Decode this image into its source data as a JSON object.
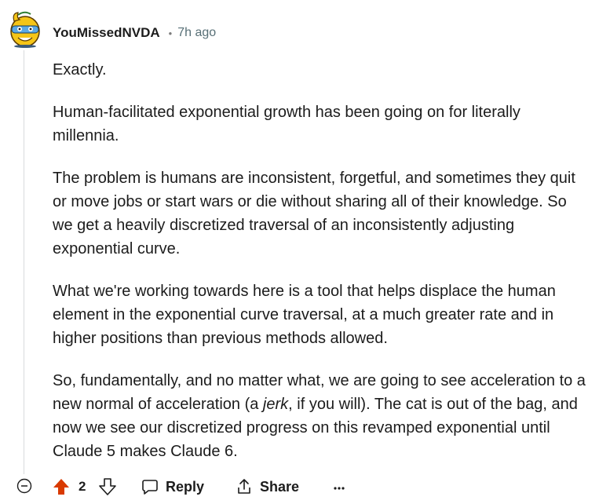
{
  "comment": {
    "username": "YouMissedNVDA",
    "separator": "•",
    "time": "7h ago",
    "paragraphs": {
      "p1": "Exactly.",
      "p2": "Human-facilitated exponential growth has been going on for literally millennia.",
      "p3": "The problem is humans are inconsistent, forgetful, and sometimes they quit or move jobs or start wars or die without sharing all of their knowledge. So we get a heavily discretized traversal of an inconsistently adjusting exponential curve.",
      "p4": "What we're working towards here is a tool that helps displace the human element in the exponential curve traversal, at a much greater rate and in higher positions than previous methods allowed.",
      "p5_before": "So, fundamentally, and no matter what, we are going to see acceleration to a new normal of acceleration (a ",
      "p5_italic": "jerk",
      "p5_after": ", if you will). The cat is out of the bag, and now we see our discretized progress on this revamped exponential until Claude 5 makes Claude 6."
    }
  },
  "actions": {
    "score": "2",
    "reply_label": "Reply",
    "share_label": "Share",
    "more_label": "···"
  },
  "colors": {
    "upvote_active": "#d93a00",
    "text": "#1c1c1c",
    "meta": "#576f76",
    "thread_line": "#d8dadc"
  },
  "icons": {
    "avatar": "snoo-avatar-icon",
    "collapse": "collapse-minus-icon",
    "upvote": "upvote-arrow-icon",
    "downvote": "downvote-arrow-icon",
    "reply": "speech-bubble-icon",
    "share": "share-icon",
    "more": "ellipsis-icon"
  }
}
